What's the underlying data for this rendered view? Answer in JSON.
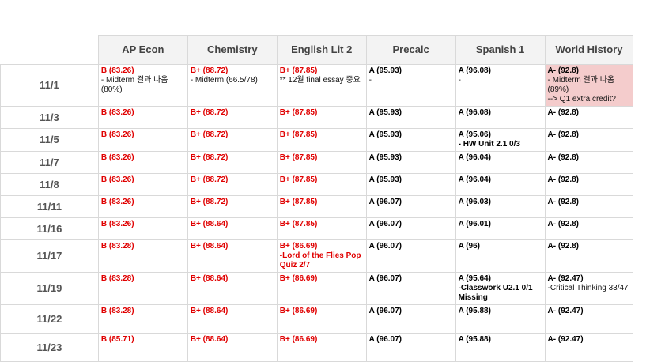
{
  "subjects": [
    "AP Econ",
    "Chemistry",
    "English Lit 2",
    "Precalc",
    "Spanish 1",
    "World History"
  ],
  "colors": {
    "red_grade": "#e00000",
    "highlight": "#f4cccc",
    "header_bg": "#f3f3f3"
  },
  "rows": [
    {
      "date": "11/1",
      "cells": [
        {
          "grade": "B (83.26)",
          "note": "- Midterm 결과 나옴 (80%)"
        },
        {
          "grade": "B+ (88.72)",
          "note": "- Midterm (66.5/78)"
        },
        {
          "grade": "B+ (87.85)",
          "note": "** 12월 final essay 중요"
        },
        {
          "grade": "A (95.93)",
          "note": "-"
        },
        {
          "grade": "A (96.08)",
          "note": "-"
        },
        {
          "grade": "A- (92.8)",
          "note": "- Midterm 결과 나옴 (89%)",
          "note2": " --> Q1 extra credit?"
        }
      ]
    },
    {
      "date": "11/3",
      "cells": [
        {
          "grade": "B (83.26)"
        },
        {
          "grade": "B+ (88.72)"
        },
        {
          "grade": "B+ (87.85)"
        },
        {
          "grade": "A (95.93)"
        },
        {
          "grade": "A (96.08)"
        },
        {
          "grade": "A- (92.8)"
        }
      ]
    },
    {
      "date": "11/5",
      "cells": [
        {
          "grade": "B (83.26)"
        },
        {
          "grade": "B+ (88.72)"
        },
        {
          "grade": "B+ (87.85)"
        },
        {
          "grade": "A (95.93)"
        },
        {
          "grade": "A (95.06)",
          "note": "- HW Unit 2.1 0/3"
        },
        {
          "grade": "A- (92.8)"
        }
      ]
    },
    {
      "date": "11/7",
      "cells": [
        {
          "grade": "B (83.26)"
        },
        {
          "grade": "B+ (88.72)"
        },
        {
          "grade": "B+ (87.85)"
        },
        {
          "grade": "A (95.93)"
        },
        {
          "grade": "A (96.04)"
        },
        {
          "grade": "A- (92.8)"
        }
      ]
    },
    {
      "date": "11/8",
      "cells": [
        {
          "grade": "B (83.26)"
        },
        {
          "grade": "B+ (88.72)"
        },
        {
          "grade": "B+ (87.85)"
        },
        {
          "grade": "A (95.93)"
        },
        {
          "grade": "A (96.04)"
        },
        {
          "grade": "A- (92.8)"
        }
      ]
    },
    {
      "date": "11/11",
      "cells": [
        {
          "grade": "B (83.26)"
        },
        {
          "grade": "B+ (88.72)"
        },
        {
          "grade": "B+ (87.85)"
        },
        {
          "grade": "A (96.07)"
        },
        {
          "grade": "A (96.03)"
        },
        {
          "grade": "A- (92.8)"
        }
      ]
    },
    {
      "date": "11/16",
      "cells": [
        {
          "grade": "B (83.26)"
        },
        {
          "grade": "B+ (88.64)"
        },
        {
          "grade": "B+ (87.85)"
        },
        {
          "grade": "A (96.07)"
        },
        {
          "grade": "A (96.01)"
        },
        {
          "grade": "A- (92.8)"
        }
      ]
    },
    {
      "date": "11/17",
      "cells": [
        {
          "grade": "B (83.28)"
        },
        {
          "grade": "B+ (88.64)"
        },
        {
          "grade": "B+ (86.69)",
          "note": "-Lord of the Flies Pop Quiz 2/7"
        },
        {
          "grade": "A (96.07)"
        },
        {
          "grade": "A (96)"
        },
        {
          "grade": "A- (92.8)"
        }
      ]
    },
    {
      "date": "11/19",
      "cells": [
        {
          "grade": "B (83.28)"
        },
        {
          "grade": "B+ (88.64)"
        },
        {
          "grade": "B+ (86.69)"
        },
        {
          "grade": "A (96.07)"
        },
        {
          "grade": "A (95.64)",
          "note": "-Classwork U2.1 0/1 Missing"
        },
        {
          "grade": "A- (92.47)",
          "note": "-Critical Thinking 33/47"
        }
      ]
    },
    {
      "date": "11/22",
      "cells": [
        {
          "grade": "B (83.28)"
        },
        {
          "grade": "B+ (88.64)"
        },
        {
          "grade": "B+ (86.69)"
        },
        {
          "grade": "A (96.07)"
        },
        {
          "grade": "A (95.88)"
        },
        {
          "grade": "A- (92.47)"
        }
      ]
    },
    {
      "date": "11/23",
      "cells": [
        {
          "grade": "B (85.71)"
        },
        {
          "grade": "B+ (88.64)"
        },
        {
          "grade": "B+ (86.69)"
        },
        {
          "grade": "A (96.07)"
        },
        {
          "grade": "A (95.88)"
        },
        {
          "grade": "A- (92.47)"
        }
      ]
    }
  ]
}
